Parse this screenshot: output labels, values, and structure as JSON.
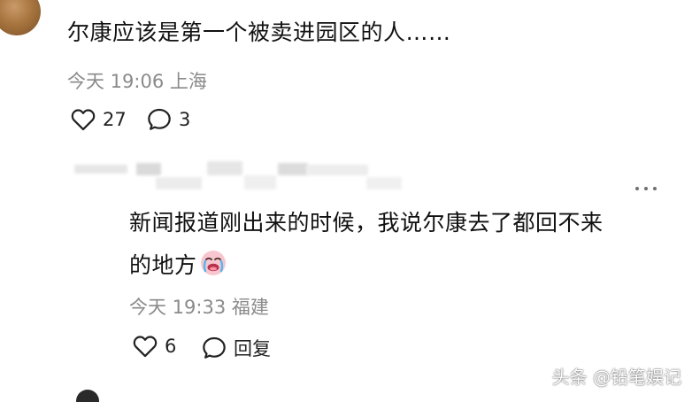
{
  "comment1": {
    "text": "尔康应该是第一个被卖进园区的人……",
    "time": "今天 19:06",
    "location": "上海",
    "likes": "27",
    "comments": "3",
    "icons": {
      "avatar": "user-avatar",
      "like": "heart-icon",
      "comment": "comment-bubble-icon"
    }
  },
  "reply": {
    "text_line1": "新闻报道刚出来的时候，我说尔康去了都回不来",
    "text_line2": "的地方",
    "time": "今天 19:33",
    "location": "福建",
    "likes": "6",
    "reply_label": "回复",
    "icons": {
      "emoji": "crying-face-emoji",
      "more": "more-icon",
      "like": "heart-icon",
      "reply": "comment-bubble-icon"
    }
  },
  "watermark": "头条 @铅笔娱记",
  "colors": {
    "text": "#111111",
    "meta": "#8a8a8a",
    "background": "#ffffff",
    "redacted": "#e6e6e6"
  }
}
